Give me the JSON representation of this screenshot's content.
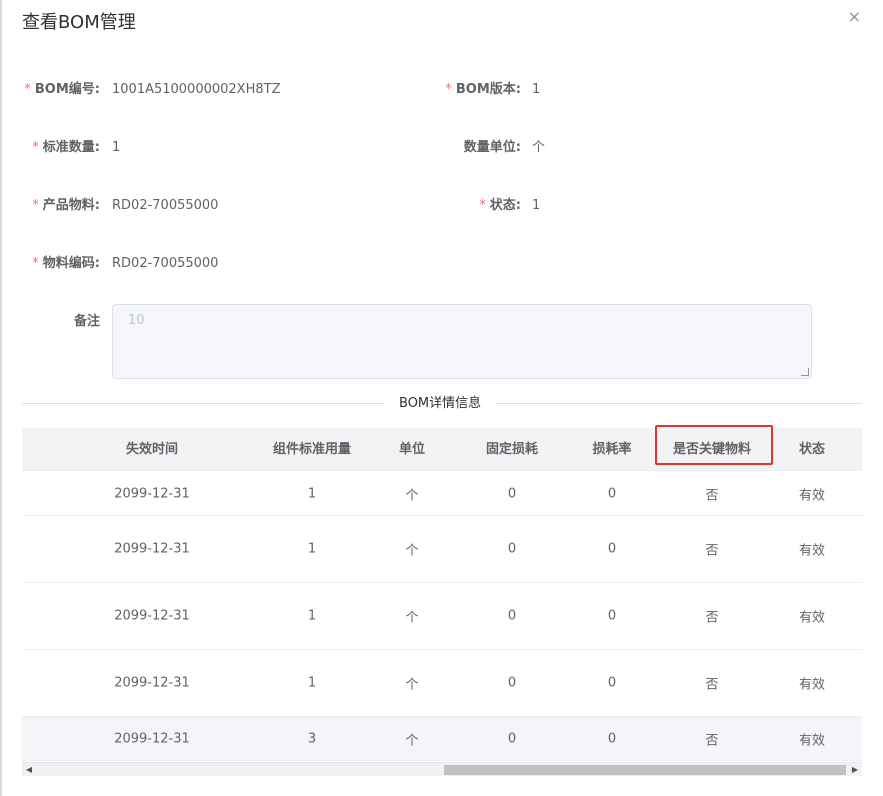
{
  "dialog": {
    "title": "查看BOM管理",
    "close_icon": "×"
  },
  "form": {
    "bom_code": {
      "label": "BOM编号:",
      "value": "1001A5100000002XH8TZ",
      "required": "*"
    },
    "bom_version": {
      "label": "BOM版本:",
      "value": "1",
      "required": "*"
    },
    "std_qty": {
      "label": "标准数量:",
      "value": "1",
      "required": "*"
    },
    "qty_unit": {
      "label": "数量单位:",
      "value": "个"
    },
    "product": {
      "label": "产品物料:",
      "value": "RD02-70055000",
      "required": "*"
    },
    "status": {
      "label": "状态:",
      "value": "1",
      "required": "*"
    },
    "material_code": {
      "label": "物料编码:",
      "value": "RD02-70055000",
      "required": "*"
    },
    "remark": {
      "label": "备注",
      "value": "10"
    }
  },
  "section": {
    "divider_label": "BOM详情信息"
  },
  "table": {
    "columns": [
      "失效时间",
      "组件标准用量",
      "单位",
      "固定损耗",
      "损耗率",
      "是否关键物料",
      "状态"
    ],
    "rows": [
      [
        "2099-12-31",
        "1",
        "个",
        "0",
        "0",
        "否",
        "有效"
      ],
      [
        "2099-12-31",
        "1",
        "个",
        "0",
        "0",
        "否",
        "有效"
      ],
      [
        "2099-12-31",
        "1",
        "个",
        "0",
        "0",
        "否",
        "有效"
      ],
      [
        "2099-12-31",
        "1",
        "个",
        "0",
        "0",
        "否",
        "有效"
      ],
      [
        "2099-12-31",
        "3",
        "个",
        "0",
        "0",
        "否",
        "有效"
      ]
    ]
  },
  "scrollbar": {
    "left_arrow": "◀",
    "right_arrow": "▶"
  },
  "colors": {
    "required": "#f56c6c",
    "highlight": "#e8312c",
    "header_bg": "#f2f3f5"
  }
}
